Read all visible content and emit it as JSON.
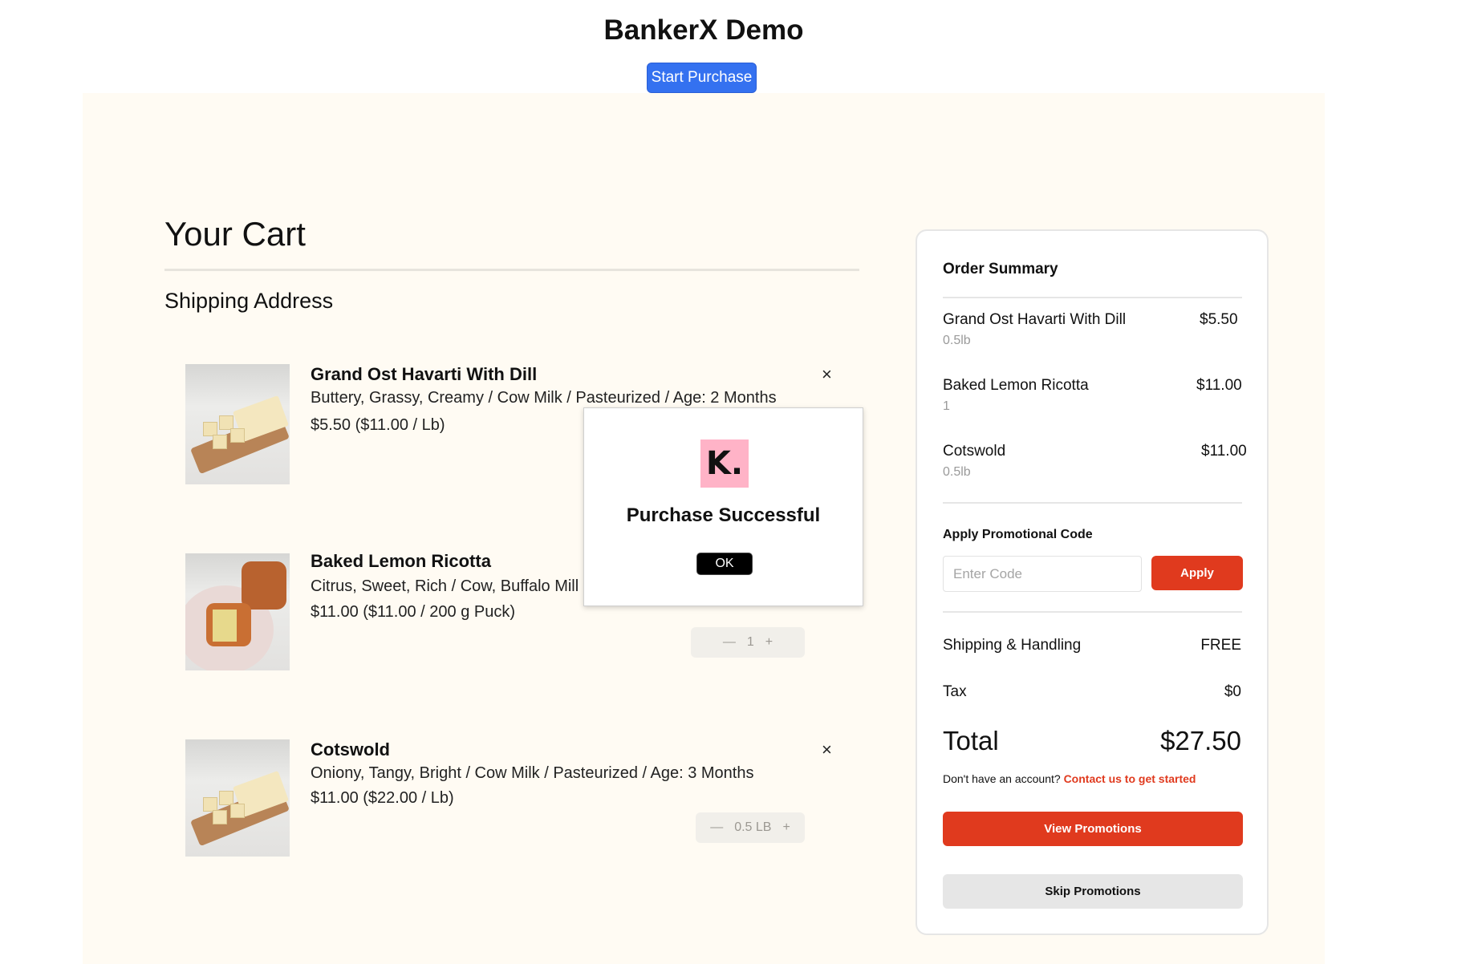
{
  "header": {
    "title": "BankerX Demo",
    "start_button": "Start Purchase"
  },
  "cart": {
    "title": "Your Cart",
    "shipping_title": "Shipping Address",
    "items": [
      {
        "name": "Grand Ost Havarti With Dill",
        "description": "Buttery, Grassy, Creamy / Cow Milk / Pasteurized / Age: 2 Months",
        "price": "$5.50 ($11.00 / Lb)",
        "remove_icon": "×"
      },
      {
        "name": "Baked Lemon Ricotta",
        "description": "Citrus, Sweet, Rich / Cow, Buffalo Mill",
        "price": "$11.00 ($11.00 / 200 g Puck)",
        "quantity": "1"
      },
      {
        "name": "Cotswold",
        "description": "Oniony, Tangy, Bright / Cow Milk / Pasteurized / Age: 3 Months",
        "price": "$11.00 ($22.00 / Lb)",
        "quantity": "0.5 LB",
        "remove_icon": "×"
      }
    ],
    "stepper": {
      "minus": "—",
      "plus": "+"
    }
  },
  "summary": {
    "title": "Order Summary",
    "items": [
      {
        "name": "Grand Ost Havarti With Dill",
        "price": "$5.50",
        "qty": "0.5lb"
      },
      {
        "name": "Baked Lemon Ricotta",
        "price": "$11.00",
        "qty": "1"
      },
      {
        "name": "Cotswold",
        "price": "$11.00",
        "qty": "0.5lb"
      }
    ],
    "promo_label": "Apply Promotional Code",
    "promo_placeholder": "Enter Code",
    "apply_button": "Apply",
    "shipping_label": "Shipping & Handling",
    "shipping_value": "FREE",
    "tax_label": "Tax",
    "tax_value": "$0",
    "total_label": "Total",
    "total_value": "$27.50",
    "account_text": "Don't have an account?",
    "account_link": "Contact us to get started",
    "view_button": "View Promotions",
    "skip_button": "Skip Promotions"
  },
  "modal": {
    "logo_text": "K.",
    "title": "Purchase Successful",
    "ok_button": "OK"
  },
  "colors": {
    "accent_red": "#e03a1e",
    "primary_blue": "#3471f0",
    "panel_bg": "#fffbf3",
    "klarna_pink": "#ffb3c7"
  }
}
